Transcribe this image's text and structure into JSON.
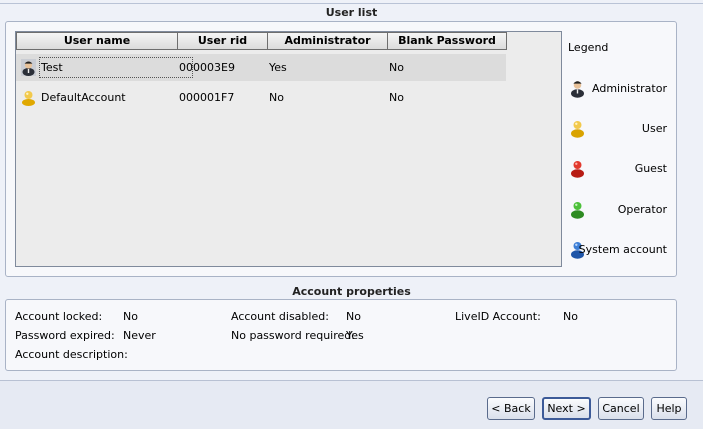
{
  "user_list": {
    "title": "User list",
    "columns": [
      "User name",
      "User rid",
      "Administrator",
      "Blank Password"
    ],
    "rows": [
      {
        "name": "Test",
        "rid": "000003E9",
        "admin": "Yes",
        "blank": "No",
        "icon": "administrator-icon"
      },
      {
        "name": "DefaultAccount",
        "rid": "000001F7",
        "admin": "No",
        "blank": "No",
        "icon": "user-icon"
      }
    ]
  },
  "legend": {
    "title": "Legend",
    "items": [
      {
        "label": "Administrator",
        "icon": "administrator-icon"
      },
      {
        "label": "User",
        "icon": "user-icon",
        "color": "#e8b400"
      },
      {
        "label": "Guest",
        "icon": "guest-icon",
        "color": "#d42a1e"
      },
      {
        "label": "Operator",
        "icon": "operator-icon",
        "color": "#3aa52c"
      },
      {
        "label": "System account",
        "icon": "system-account-icon",
        "color": "#2f6fc4"
      }
    ]
  },
  "account_properties": {
    "title": "Account properties",
    "locked_label": "Account locked:",
    "locked_value": "No",
    "disabled_label": "Account disabled:",
    "disabled_value": "No",
    "liveid_label": "LiveID Account:",
    "liveid_value": "No",
    "expired_label": "Password expired:",
    "expired_value": "Never",
    "nopass_label": "No password required:",
    "nopass_value": "Yes",
    "description_label": "Account description:"
  },
  "buttons": {
    "back": "< Back",
    "next": "Next >",
    "cancel": "Cancel",
    "help": "Help"
  }
}
